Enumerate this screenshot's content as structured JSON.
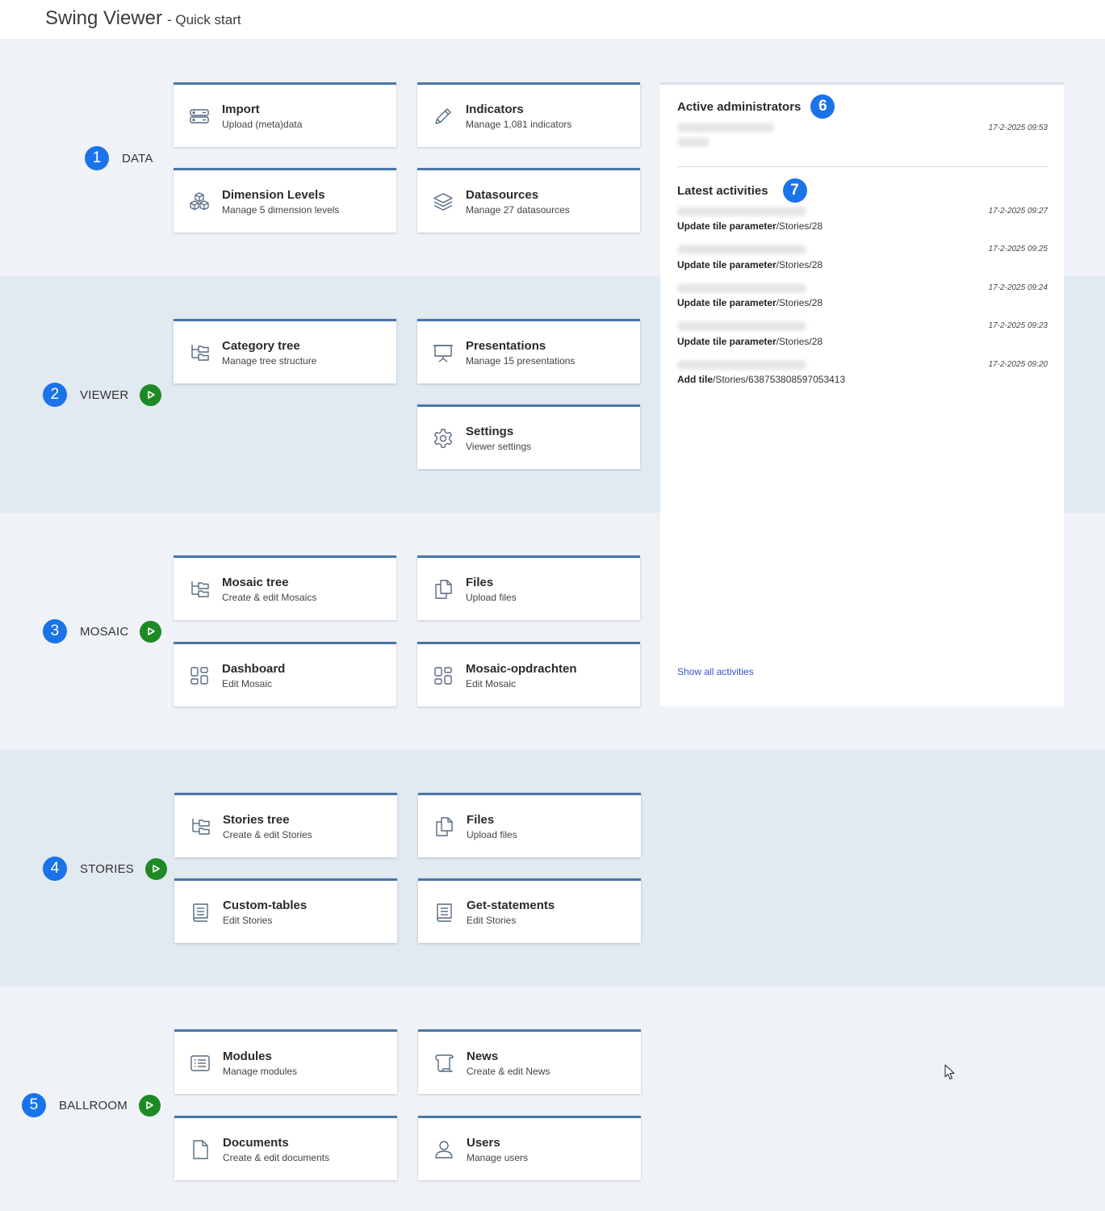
{
  "header": {
    "title": "Swing Viewer",
    "subtitle": "- Quick start"
  },
  "sections": [
    {
      "number": "1",
      "label": "DATA",
      "has_play": false
    },
    {
      "number": "2",
      "label": "VIEWER",
      "has_play": true
    },
    {
      "number": "3",
      "label": "MOSAIC",
      "has_play": true
    },
    {
      "number": "4",
      "label": "STORIES",
      "has_play": true
    },
    {
      "number": "5",
      "label": "BALLROOM",
      "has_play": true
    }
  ],
  "tiles": {
    "import": {
      "title": "Import",
      "subtitle": "Upload (meta)data",
      "icon": "server-icon"
    },
    "indicators": {
      "title": "Indicators",
      "subtitle": "Manage 1,081 indicators",
      "icon": "pencil-icon"
    },
    "dimension_levels": {
      "title": "Dimension Levels",
      "subtitle": "Manage 5 dimension levels",
      "icon": "cubes-icon"
    },
    "datasources": {
      "title": "Datasources",
      "subtitle": "Manage 27 datasources",
      "icon": "layers-icon"
    },
    "category_tree": {
      "title": "Category tree",
      "subtitle": "Manage tree structure",
      "icon": "tree-icon"
    },
    "presentations": {
      "title": "Presentations",
      "subtitle": "Manage 15 presentations",
      "icon": "presentation-icon"
    },
    "settings": {
      "title": "Settings",
      "subtitle": "Viewer settings",
      "icon": "gear-icon"
    },
    "mosaic_tree": {
      "title": "Mosaic tree",
      "subtitle": "Create & edit Mosaics",
      "icon": "tree-icon"
    },
    "mosaic_files": {
      "title": "Files",
      "subtitle": "Upload files",
      "icon": "files-icon"
    },
    "dashboard": {
      "title": "Dashboard",
      "subtitle": "Edit Mosaic",
      "icon": "dashboard-icon"
    },
    "mosaic_opdrachten": {
      "title": "Mosaic-opdrachten",
      "subtitle": "Edit Mosaic",
      "icon": "dashboard-icon"
    },
    "stories_tree": {
      "title": "Stories tree",
      "subtitle": "Create & edit Stories",
      "icon": "tree-icon"
    },
    "stories_files": {
      "title": "Files",
      "subtitle": "Upload files",
      "icon": "files-icon"
    },
    "custom_tables": {
      "title": "Custom-tables",
      "subtitle": "Edit Stories",
      "icon": "book-icon"
    },
    "get_statements": {
      "title": "Get-statements",
      "subtitle": "Edit Stories",
      "icon": "book-icon"
    },
    "modules": {
      "title": "Modules",
      "subtitle": "Manage modules",
      "icon": "list-icon"
    },
    "news": {
      "title": "News",
      "subtitle": "Create & edit News",
      "icon": "scroll-icon"
    },
    "documents": {
      "title": "Documents",
      "subtitle": "Create & edit documents",
      "icon": "document-icon"
    },
    "users": {
      "title": "Users",
      "subtitle": "Manage users",
      "icon": "user-icon"
    }
  },
  "panel": {
    "admins_title": "Active administrators",
    "admins_badge": "6",
    "admins": [
      {
        "time": "17-2-2025 09:53"
      }
    ],
    "activities_title": "Latest activities",
    "activities_badge": "7",
    "activities": [
      {
        "time": "17-2-2025 09:27",
        "action": "Update tile parameter",
        "path": "/Stories/28"
      },
      {
        "time": "17-2-2025 09:25",
        "action": "Update tile parameter",
        "path": "/Stories/28"
      },
      {
        "time": "17-2-2025 09:24",
        "action": "Update tile parameter",
        "path": "/Stories/28"
      },
      {
        "time": "17-2-2025 09:23",
        "action": "Update tile parameter",
        "path": "/Stories/28"
      },
      {
        "time": "17-2-2025 09:20",
        "action": "Add tile",
        "path": "/Stories/638753808597053413"
      }
    ],
    "show_all": "Show all activities"
  },
  "colors": {
    "accent": "#1a73e8",
    "play": "#1e8a24",
    "tile_border": "#4a76a8",
    "link": "#3355cc"
  }
}
